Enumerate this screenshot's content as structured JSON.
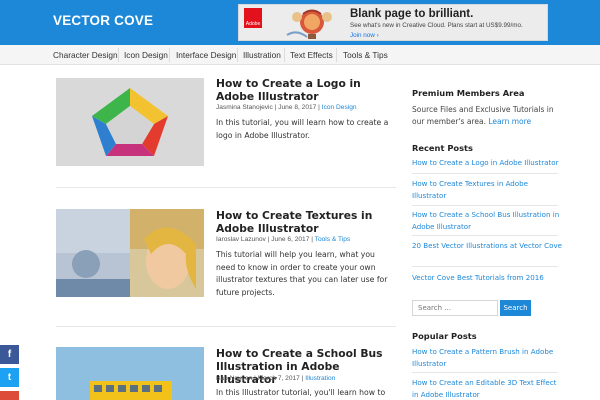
{
  "site": {
    "logo": "VECTOR COVE"
  },
  "ad": {
    "brand": "Adobe",
    "headline": "Blank page to brilliant.",
    "line": "See what's new in Creative Cloud. Plans start at US$9.99/mo.",
    "cta": "Join now ›"
  },
  "nav": {
    "items": [
      "Character Design",
      "Icon Design",
      "Interface Design",
      "Illustration",
      "Text Effects",
      "Tools & Tips"
    ]
  },
  "posts": [
    {
      "title": "How to Create a Logo in Adobe Illustrator",
      "author": "Jasmina Stanojevic",
      "date": "June 8, 2017",
      "category": "Icon Design",
      "excerpt": "In this tutorial, you will learn how to create a logo in Adobe Illustrator."
    },
    {
      "title": "How to Create Textures in Adobe Illustrator",
      "author": "Iaroslav Lazunov",
      "date": "June 6, 2017",
      "category": "Tools & Tips",
      "excerpt": "This tutorial will help you learn, what you need to know in order to create your own illustrator textures that you can later use for future projects."
    },
    {
      "title": "How to Create a School Bus Illustration in Adobe Illustrator",
      "author": "Bao Nguyen",
      "date": "March 7, 2017",
      "category": "Illustration",
      "excerpt": "In this Illustrator tutorial, you'll learn how to"
    }
  ],
  "sidebar": {
    "premium": {
      "title": "Premium Members Area",
      "text": "Source Files and Exclusive Tutorials in our member's area.",
      "link": "Learn more"
    },
    "recent": {
      "title": "Recent Posts",
      "items": [
        "How to Create a Logo in Adobe Illustrator",
        "How to Create Textures in Adobe Illustrator",
        "How to Create a School Bus Illustration in Adobe Illustrator",
        "20 Best Vector Illustrations at Vector Cove",
        "Vector Cove Best Tutorials from 2016"
      ]
    },
    "search": {
      "placeholder": "Search ...",
      "button": "Search"
    },
    "popular": {
      "title": "Popular Posts",
      "items": [
        "How to Create a Pattern Brush in Adobe Illustrator",
        "How to Create an Editable 3D Text Effect in Adobe Illustrator"
      ]
    }
  },
  "social": [
    {
      "name": "facebook",
      "glyph": "f",
      "color": "#3b5998"
    },
    {
      "name": "twitter",
      "glyph": "t",
      "color": "#1da1f2"
    }
  ]
}
